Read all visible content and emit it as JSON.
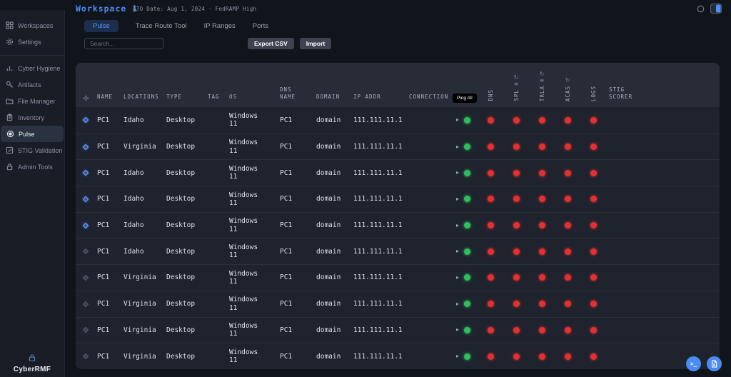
{
  "brand": "CyberRMF",
  "topbar": {
    "title": "Workspace 1",
    "subtitle": "ATO Date: Aug 1, 2024 · FedRAMP High"
  },
  "sidebar": {
    "primary": [
      {
        "label": "Workspaces",
        "icon": "grid-icon"
      },
      {
        "label": "Settings",
        "icon": "gear-icon"
      }
    ],
    "items": [
      {
        "label": "Cyber Hygiene",
        "icon": "bar-chart-icon",
        "active": false
      },
      {
        "label": "Artifacts",
        "icon": "key-icon",
        "active": false
      },
      {
        "label": "File Manager",
        "icon": "folder-icon",
        "active": false
      },
      {
        "label": "Inventory",
        "icon": "clipboard-icon",
        "active": false
      },
      {
        "label": "Pulse",
        "icon": "target-icon",
        "active": true
      },
      {
        "label": "STIG Validation",
        "icon": "check-square-icon",
        "active": false
      },
      {
        "label": "Admin Tools",
        "icon": "lock-icon",
        "active": false
      }
    ]
  },
  "tabs": [
    {
      "label": "Pulse",
      "active": true
    },
    {
      "label": "Trace Route Tool",
      "active": false
    },
    {
      "label": "IP Ranges",
      "active": false
    },
    {
      "label": "Ports",
      "active": false
    }
  ],
  "toolbar": {
    "search_placeholder": "Search...",
    "export_csv": "Export CSV",
    "import": "Import"
  },
  "table": {
    "columns": {
      "name": "NAME",
      "locations": "LOCATIONS",
      "type": "TYPE",
      "tag": "TAG",
      "os": "OS",
      "dns_name": "DNS NAME",
      "domain": "DOMAIN",
      "ip_addr": "IP ADDR",
      "connection": "CONNECTION",
      "stig": "STIG SCORER"
    },
    "ping_all": "Ping All",
    "status_columns": [
      "DNS",
      "SPL",
      "TRLX",
      "ACAS",
      "LOGS"
    ],
    "rows": [
      {
        "name": "PC1",
        "location": "Idaho",
        "type": "Desktop",
        "tag": "",
        "os": "Windows 11",
        "dns_name": "PC1",
        "domain": "domain",
        "ip_addr": "111.111.11.1",
        "selected": true,
        "connection": "up",
        "statuses": [
          "down",
          "down",
          "down",
          "down",
          "down"
        ],
        "stig_score": ""
      },
      {
        "name": "PC1",
        "location": "Virginia",
        "type": "Desktop",
        "tag": "",
        "os": "Windows 11",
        "dns_name": "PC1",
        "domain": "domain",
        "ip_addr": "111.111.11.1",
        "selected": true,
        "connection": "up",
        "statuses": [
          "down",
          "down",
          "down",
          "down",
          "down"
        ],
        "stig_score": ""
      },
      {
        "name": "PC1",
        "location": "Idaho",
        "type": "Desktop",
        "tag": "",
        "os": "Windows 11",
        "dns_name": "PC1",
        "domain": "domain",
        "ip_addr": "111.111.11.1",
        "selected": true,
        "connection": "up",
        "statuses": [
          "down",
          "down",
          "down",
          "down",
          "down"
        ],
        "stig_score": ""
      },
      {
        "name": "PC1",
        "location": "Idaho",
        "type": "Desktop",
        "tag": "",
        "os": "Windows 11",
        "dns_name": "PC1",
        "domain": "domain",
        "ip_addr": "111.111.11.1",
        "selected": true,
        "connection": "up",
        "statuses": [
          "down",
          "down",
          "down",
          "down",
          "down"
        ],
        "stig_score": ""
      },
      {
        "name": "PC1",
        "location": "Idaho",
        "type": "Desktop",
        "tag": "",
        "os": "Windows 11",
        "dns_name": "PC1",
        "domain": "domain",
        "ip_addr": "111.111.11.1",
        "selected": true,
        "connection": "up",
        "statuses": [
          "down",
          "down",
          "down",
          "down",
          "down"
        ],
        "stig_score": ""
      },
      {
        "name": "PC1",
        "location": "Idaho",
        "type": "Desktop",
        "tag": "",
        "os": "Windows 11",
        "dns_name": "PC1",
        "domain": "domain",
        "ip_addr": "111.111.11.1",
        "selected": false,
        "connection": "up",
        "statuses": [
          "down",
          "down",
          "down",
          "down",
          "down"
        ],
        "stig_score": ""
      },
      {
        "name": "PC1",
        "location": "Virginia",
        "type": "Desktop",
        "tag": "",
        "os": "Windows 11",
        "dns_name": "PC1",
        "domain": "domain",
        "ip_addr": "111.111.11.1",
        "selected": false,
        "connection": "up",
        "statuses": [
          "down",
          "down",
          "down",
          "down",
          "down"
        ],
        "stig_score": ""
      },
      {
        "name": "PC1",
        "location": "Virginia",
        "type": "Desktop",
        "tag": "",
        "os": "Windows 11",
        "dns_name": "PC1",
        "domain": "domain",
        "ip_addr": "111.111.11.1",
        "selected": false,
        "connection": "up",
        "statuses": [
          "down",
          "down",
          "down",
          "down",
          "down"
        ],
        "stig_score": ""
      },
      {
        "name": "PC1",
        "location": "Virginia",
        "type": "Desktop",
        "tag": "",
        "os": "Windows 11",
        "dns_name": "PC1",
        "domain": "domain",
        "ip_addr": "111.111.11.1",
        "selected": false,
        "connection": "up",
        "statuses": [
          "down",
          "down",
          "down",
          "down",
          "down"
        ],
        "stig_score": ""
      },
      {
        "name": "PC1",
        "location": "Virginia",
        "type": "Desktop",
        "tag": "",
        "os": "Windows 11",
        "dns_name": "PC1",
        "domain": "domain",
        "ip_addr": "111.111.11.1",
        "selected": false,
        "connection": "up",
        "statuses": [
          "down",
          "down",
          "down",
          "down",
          "down"
        ],
        "stig_score": ""
      }
    ]
  },
  "icons": {
    "play": "▸",
    "refresh": "↻",
    "menu": "≡",
    "terminal": ">_"
  },
  "colors": {
    "accent": "#4f8ef7",
    "status_up": "#2fbf5a",
    "status_down": "#e33030"
  }
}
